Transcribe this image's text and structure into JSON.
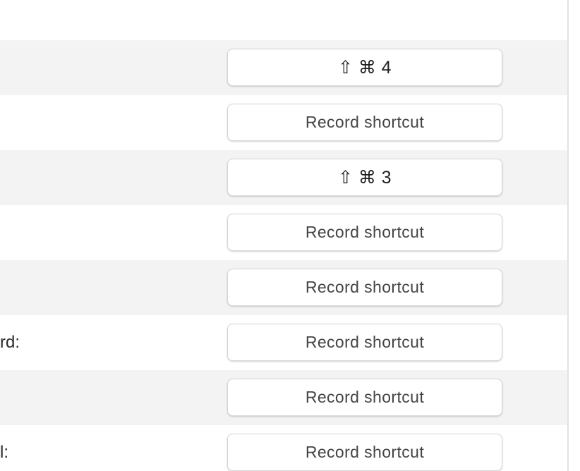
{
  "rows": [
    {
      "label": "",
      "button": "⇧ ⌘ 4",
      "set": true,
      "shaded": true
    },
    {
      "label": "",
      "button": "Record shortcut",
      "set": false,
      "shaded": false
    },
    {
      "label": "",
      "button": "⇧ ⌘ 3",
      "set": true,
      "shaded": true
    },
    {
      "label": "",
      "button": "Record shortcut",
      "set": false,
      "shaded": false
    },
    {
      "label": "",
      "button": "Record shortcut",
      "set": false,
      "shaded": true
    },
    {
      "label": "rd:",
      "button": "Record shortcut",
      "set": false,
      "shaded": false
    },
    {
      "label": "",
      "button": "Record shortcut",
      "set": false,
      "shaded": true
    },
    {
      "label": "l:",
      "button": "Record shortcut",
      "set": false,
      "shaded": false
    }
  ]
}
